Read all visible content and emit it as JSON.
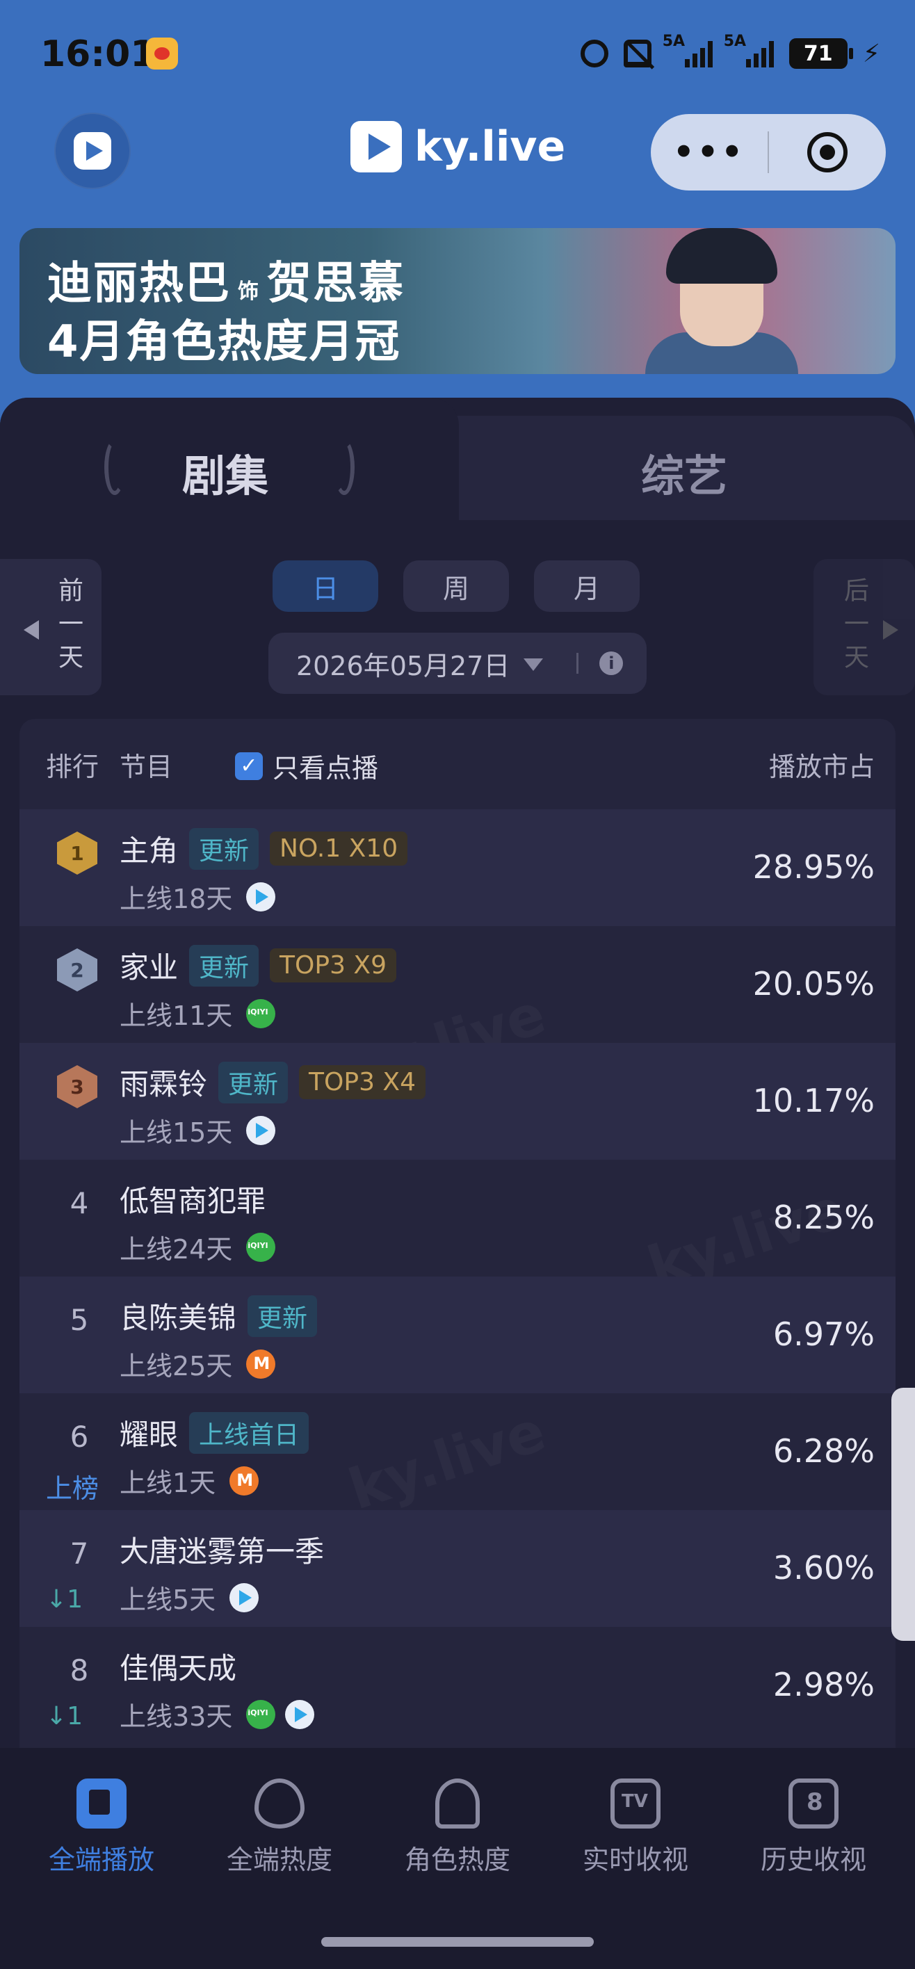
{
  "status_bar": {
    "time": "16:01",
    "signal1_label": "5A",
    "signal2_label": "5A",
    "battery": "71"
  },
  "header": {
    "brand": "ky.live",
    "more_label": "•••"
  },
  "banner": {
    "line1_name": "迪丽热巴",
    "line1_as": "饰",
    "line1_role": "贺思慕",
    "line2": "4月角色热度月冠"
  },
  "category_tabs": {
    "drama": "剧集",
    "variety": "综艺"
  },
  "date_nav": {
    "prev_label": "前一天",
    "next_label": "后一天",
    "periods": [
      "日",
      "周",
      "月"
    ],
    "active_period": "日",
    "date": "2026年05月27日"
  },
  "table": {
    "header_rank": "排行",
    "header_show": "节目",
    "filter_label": "只看点播",
    "filter_checked": true,
    "header_share": "播放市占",
    "rows": [
      {
        "rank": "1",
        "title": "主角",
        "badges": [
          "更新",
          "NO.1 X10"
        ],
        "days": "上线18天",
        "platforms": [
          "tencent"
        ],
        "share": "28.95%",
        "change": ""
      },
      {
        "rank": "2",
        "title": "家业",
        "badges": [
          "更新",
          "TOP3 X9"
        ],
        "days": "上线11天",
        "platforms": [
          "iqiyi"
        ],
        "share": "20.05%",
        "change": ""
      },
      {
        "rank": "3",
        "title": "雨霖铃",
        "badges": [
          "更新",
          "TOP3 X4"
        ],
        "days": "上线15天",
        "platforms": [
          "tencent"
        ],
        "share": "10.17%",
        "change": ""
      },
      {
        "rank": "4",
        "title": "低智商犯罪",
        "badges": [],
        "days": "上线24天",
        "platforms": [
          "iqiyi"
        ],
        "share": "8.25%",
        "change": ""
      },
      {
        "rank": "5",
        "title": "良陈美锦",
        "badges": [
          "更新"
        ],
        "days": "上线25天",
        "platforms": [
          "mango"
        ],
        "share": "6.97%",
        "change": ""
      },
      {
        "rank": "6",
        "title": "耀眼",
        "badges": [
          "上线首日"
        ],
        "days": "上线1天",
        "platforms": [
          "mango"
        ],
        "share": "6.28%",
        "change": "上榜"
      },
      {
        "rank": "7",
        "title": "大唐迷雾第一季",
        "badges": [],
        "days": "上线5天",
        "platforms": [
          "tencent"
        ],
        "share": "3.60%",
        "change": "↓1"
      },
      {
        "rank": "8",
        "title": "佳偶天成",
        "badges": [],
        "days": "上线33天",
        "platforms": [
          "iqiyi",
          "tencent"
        ],
        "share": "2.98%",
        "change": "↓1"
      }
    ]
  },
  "bottom_nav": {
    "items": [
      "全端播放",
      "全端热度",
      "角色热度",
      "实时收视",
      "历史收视"
    ],
    "active": "全端播放"
  },
  "colors": {
    "accent": "#3f7fe0",
    "header_bg": "#3a6fbe",
    "page_bg": "#1f1f35"
  }
}
